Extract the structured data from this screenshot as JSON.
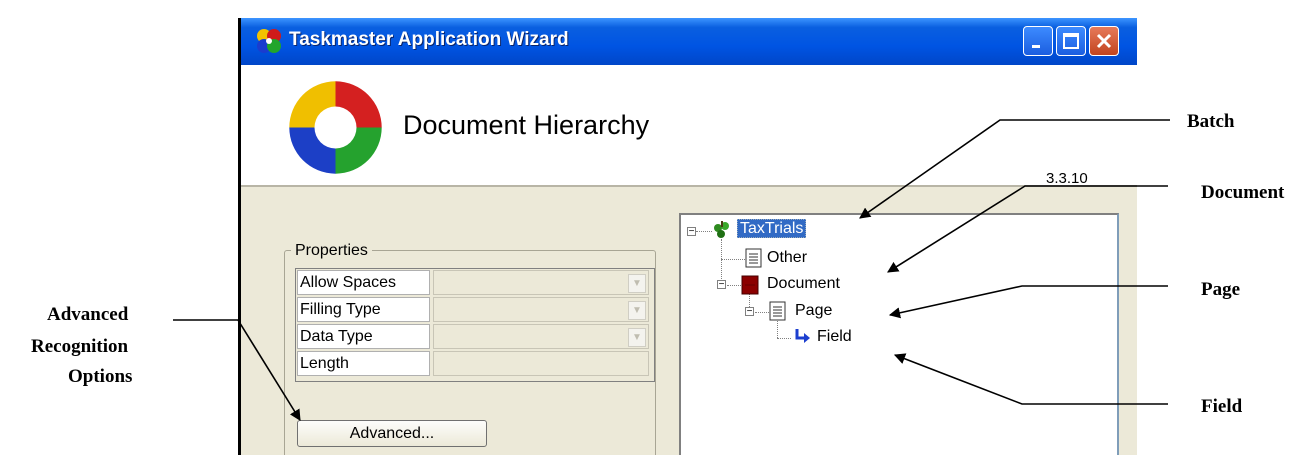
{
  "window": {
    "title": "Taskmaster Application Wizard",
    "controls": [
      "minimize",
      "maximize",
      "close"
    ]
  },
  "header": {
    "title": "Document Hierarchy",
    "version": "3.3.10"
  },
  "properties": {
    "legend": "Properties",
    "rows": [
      {
        "label": "Allow Spaces",
        "has_dropdown": true
      },
      {
        "label": "Filling Type",
        "has_dropdown": true
      },
      {
        "label": "Data Type",
        "has_dropdown": true
      },
      {
        "label": "Length",
        "has_dropdown": false
      }
    ],
    "advanced_button": "Advanced..."
  },
  "tree": {
    "nodes": [
      {
        "label": "TaxTrials",
        "icon": "batch-icon",
        "selected": true
      },
      {
        "label": "Other",
        "icon": "page-icon"
      },
      {
        "label": "Document",
        "icon": "document-icon"
      },
      {
        "label": "Page",
        "icon": "page-icon"
      },
      {
        "label": "Field",
        "icon": "field-arrow-icon"
      }
    ]
  },
  "callouts": {
    "batch": "Batch",
    "document": "Document",
    "page": "Page",
    "field": "Field",
    "advanced_line1": "Advanced",
    "advanced_line2": "Recognition",
    "advanced_line3": "Options"
  }
}
